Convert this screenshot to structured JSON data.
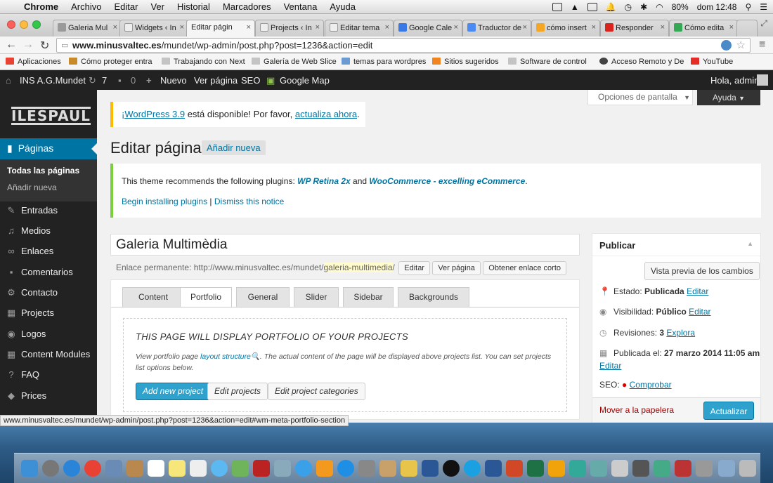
{
  "macbar": {
    "app": "Chrome",
    "menus": [
      "Archivo",
      "Editar",
      "Ver",
      "Historial",
      "Marcadores",
      "Ventana",
      "Ayuda"
    ],
    "battery": "80%",
    "clock": "dom 12:48"
  },
  "tabs": [
    {
      "label": "Galeria Mul",
      "active": false
    },
    {
      "label": "Widgets ‹ In",
      "active": false
    },
    {
      "label": "Editar págin",
      "active": true
    },
    {
      "label": "Projects ‹ In",
      "active": false
    },
    {
      "label": "Editar tema",
      "active": false
    },
    {
      "label": "Google Cale",
      "active": false
    },
    {
      "label": "Traductor de",
      "active": false
    },
    {
      "label": "cómo insert",
      "active": false
    },
    {
      "label": "Responder",
      "active": false
    },
    {
      "label": "Cómo edita",
      "active": false
    }
  ],
  "address": {
    "host": "www.minusvaltec.es",
    "path": "/mundet/wp-admin/post.php?post=1236&action=edit"
  },
  "bookmarks": [
    "Aplicaciones",
    "Cómo proteger entra",
    "Trabajando con Next",
    "Galería de Web Slice",
    "temas para wordpres",
    "Sitios sugeridos",
    "Software de control",
    "Acceso Remoto y De",
    "YouTube"
  ],
  "adminbar": {
    "site": "INS A.G.Mundet",
    "updates": "7",
    "comments": "0",
    "new": "Nuevo",
    "view": "Ver página",
    "seo": "SEO",
    "map": "Google Map",
    "greeting": "Hola, admin"
  },
  "screen_options": "Opciones de pantalla",
  "help": "Ayuda",
  "logo_text": "ILESPAUL",
  "sidebar": {
    "current": "Páginas",
    "sub": [
      "Todas las páginas",
      "Añadir nueva"
    ],
    "items": [
      {
        "label": "Entradas",
        "icon": "pin-icon"
      },
      {
        "label": "Medios",
        "icon": "media-icon"
      },
      {
        "label": "Enlaces",
        "icon": "link-icon"
      },
      {
        "label": "Comentarios",
        "icon": "comment-icon"
      },
      {
        "label": "Contacto",
        "icon": "gear-icon"
      },
      {
        "label": "Projects",
        "icon": "grid-icon"
      },
      {
        "label": "Logos",
        "icon": "eye-icon"
      },
      {
        "label": "Content Modules",
        "icon": "grid-icon"
      },
      {
        "label": "FAQ",
        "icon": "question-icon"
      },
      {
        "label": "Prices",
        "icon": "tag-icon"
      }
    ]
  },
  "update_notice": {
    "link": "¡WordPress 3.9",
    "mid": " está disponible! Por favor, ",
    "action": "actualiza ahora",
    "end": "."
  },
  "page_title": "Editar página",
  "add_new": "Añadir nueva",
  "plugin_notice": {
    "prefix": "This theme recommends the following plugins: ",
    "p1": "WP Retina 2x",
    "and": " and ",
    "p2": "WooCommerce - excelling eCommerce",
    "end": ".",
    "install": "Begin installing plugins",
    "sep": " | ",
    "dismiss": "Dismiss this notice"
  },
  "post_title": "Galeria Multimèdia",
  "permalink": {
    "label": "Enlace permanente: ",
    "base": "http://www.minusvaltec.es/mundet/",
    "slug": "galeria-multimedia",
    "trail": "/",
    "edit": "Editar",
    "view": "Ver página",
    "short": "Obtener enlace corto"
  },
  "meta_tabs": [
    "Content",
    "Portfolio",
    "General",
    "Slider",
    "Sidebar",
    "Backgrounds"
  ],
  "portfolio": {
    "heading": "THIS PAGE WILL DISPLAY PORTFOLIO OF YOUR PROJECTS",
    "desc_pre": "View portfolio page ",
    "desc_link": "layout structure",
    "desc_post": ". The actual content of the page will be displayed above projects list. You can set projects list options below.",
    "btn_add": "Add new project",
    "btn_edit": "Edit projects",
    "btn_cats": "Edit project categories"
  },
  "publish": {
    "title": "Publicar",
    "preview": "Vista previa de los cambios",
    "status_label": "Estado: ",
    "status": "Publicada",
    "edit": "Editar",
    "visibility_label": "Visibilidad: ",
    "visibility": "Público",
    "revisions_label": "Revisiones: ",
    "revisions": "3",
    "explore": "Explora",
    "published_label": "Publicada el: ",
    "published": "27 marzo 2014 11:05 am",
    "seo_label": "SEO: ",
    "seo_check": "Comprobar",
    "trash": "Mover a la papelera",
    "update": "Actualizar"
  },
  "status_url": "www.minusvaltec.es/mundet/wp-admin/post.php?post=1236&action=edit#wm-meta-portfolio-section",
  "colors": {
    "wp_blue": "#0074a2",
    "admin_dark": "#222222",
    "notice_yellow": "#ffba00",
    "notice_green": "#7ad03a",
    "trash_red": "#a00000"
  }
}
